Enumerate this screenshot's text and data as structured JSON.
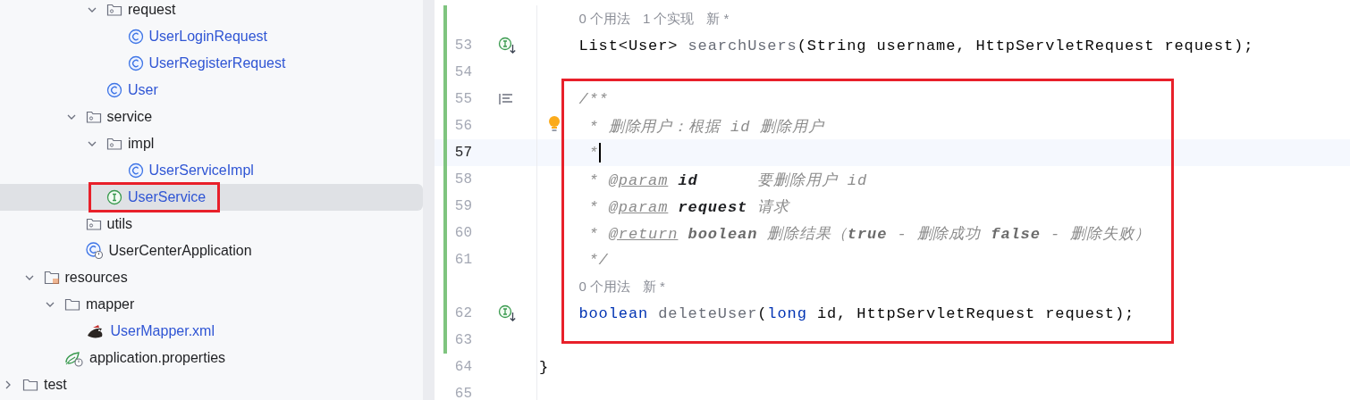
{
  "project_tree": [
    {
      "children": [
        {
          "children": [
            {
              "children": [
                {
                  "children": [
                    {
                      "name": "request",
                      "kind": "package",
                      "expanded": true,
                      "selected": false,
                      "added": false,
                      "children": [
                        {
                          "name": "UserLoginRequest",
                          "kind": "class",
                          "selected": false,
                          "added": true
                        },
                        {
                          "name": "UserRegisterRequest",
                          "kind": "class",
                          "selected": false,
                          "added": true
                        }
                      ]
                    },
                    {
                      "name": "User",
                      "kind": "class",
                      "selected": false,
                      "added": true
                    }
                  ]
                },
                {
                  "name": "service",
                  "kind": "package",
                  "expanded": true,
                  "selected": false,
                  "added": false,
                  "children": [
                    {
                      "name": "impl",
                      "kind": "package",
                      "expanded": true,
                      "selected": false,
                      "added": false,
                      "children": [
                        {
                          "name": "UserServiceImpl",
                          "kind": "class",
                          "selected": false,
                          "added": true
                        }
                      ]
                    },
                    {
                      "name": "UserService",
                      "kind": "interface",
                      "selected": true,
                      "added": true,
                      "boxed": true
                    }
                  ]
                },
                {
                  "name": "utils",
                  "kind": "package",
                  "selected": false,
                  "added": false
                },
                {
                  "name": "UserCenterApplication",
                  "kind": "app",
                  "selected": false,
                  "added": false
                }
              ]
            }
          ]
        },
        {
          "name": "resources",
          "kind": "resources",
          "expanded": true,
          "selected": false,
          "added": false,
          "children": [
            {
              "name": "mapper",
              "kind": "folder",
              "expanded": true,
              "selected": false,
              "added": false,
              "children": [
                {
                  "name": "UserMapper.xml",
                  "kind": "mybatis",
                  "selected": false,
                  "added": true
                }
              ]
            },
            {
              "name": "application.properties",
              "kind": "properties",
              "selected": false,
              "added": false
            }
          ]
        }
      ]
    },
    {
      "name": "test",
      "kind": "folder",
      "expanded": false,
      "selected": false,
      "added": false
    }
  ],
  "editor": {
    "blocks": [
      {
        "kind": "member",
        "boxed": false,
        "lines": [
          {
            "kind": "hint",
            "changed": true,
            "hints": [
              "0 个用法",
              "1 个实现",
              "新 *"
            ]
          },
          {
            "kind": "code",
            "number": "53",
            "changed": true,
            "current": false,
            "gutter": {
              "kind": "implemented"
            },
            "tokens": [
              {
                "text": "List<User> ",
                "kind": "plain"
              },
              {
                "text": "searchUsers",
                "kind": "method"
              },
              {
                "text": "(String username, HttpServletRequest request);",
                "kind": "plain"
              }
            ]
          },
          {
            "kind": "code",
            "number": "54",
            "changed": true,
            "current": false
          }
        ]
      },
      {
        "kind": "member",
        "boxed": true,
        "lines": [
          {
            "kind": "code",
            "number": "55",
            "changed": true,
            "current": false,
            "gutter": {
              "kind": "doc"
            },
            "tokens": [
              {
                "text": "/**",
                "kind": "comment"
              }
            ]
          },
          {
            "kind": "code",
            "number": "56",
            "changed": true,
            "current": false,
            "bulb": true,
            "tokens": [
              {
                "text": " * 删除用户：根据 id 删除用户",
                "kind": "comment"
              }
            ]
          },
          {
            "kind": "code",
            "number": "57",
            "changed": true,
            "current": true,
            "tokens": [
              {
                "text": " *",
                "kind": "comment"
              }
            ]
          },
          {
            "kind": "code",
            "number": "58",
            "changed": true,
            "current": false,
            "tokens": [
              {
                "text": " * ",
                "kind": "comment"
              },
              {
                "text": "@param",
                "kind": "doc-tag"
              },
              {
                "text": " id",
                "kind": "doc-param"
              },
              {
                "text": "      要删除用户 id",
                "kind": "comment"
              }
            ]
          },
          {
            "kind": "code",
            "number": "59",
            "changed": true,
            "current": false,
            "tokens": [
              {
                "text": " * ",
                "kind": "comment"
              },
              {
                "text": "@param",
                "kind": "doc-tag"
              },
              {
                "text": " request",
                "kind": "doc-param"
              },
              {
                "text": " 请求",
                "kind": "comment"
              }
            ]
          },
          {
            "kind": "code",
            "number": "60",
            "changed": true,
            "current": false,
            "tokens": [
              {
                "text": " * ",
                "kind": "comment"
              },
              {
                "text": "@return",
                "kind": "doc-tag"
              },
              {
                "text": " boolean",
                "kind": "doc-value"
              },
              {
                "text": " 删除结果（",
                "kind": "comment"
              },
              {
                "text": "true",
                "kind": "doc-value"
              },
              {
                "text": " - 删除成功 ",
                "kind": "comment"
              },
              {
                "text": "false",
                "kind": "doc-value"
              },
              {
                "text": " - 删除失败）",
                "kind": "comment"
              }
            ]
          },
          {
            "kind": "code",
            "number": "61",
            "changed": true,
            "current": false,
            "tokens": [
              {
                "text": " */",
                "kind": "comment"
              }
            ]
          },
          {
            "kind": "hint",
            "changed": true,
            "hints": [
              "0 个用法",
              "新 *"
            ]
          },
          {
            "kind": "code",
            "number": "62",
            "changed": true,
            "current": false,
            "gutter": {
              "kind": "implemented"
            },
            "tokens": [
              {
                "text": "boolean ",
                "kind": "keyword"
              },
              {
                "text": "deleteUser",
                "kind": "method"
              },
              {
                "text": "(",
                "kind": "plain"
              },
              {
                "text": "long",
                "kind": "keyword"
              },
              {
                "text": " id, HttpServletRequest request);",
                "kind": "plain"
              }
            ]
          },
          {
            "kind": "code",
            "number": "63",
            "changed": true,
            "current": false
          }
        ]
      },
      {
        "kind": "top",
        "boxed": false,
        "lines": [
          {
            "kind": "code",
            "number": "64",
            "changed": false,
            "current": false,
            "tokens": [
              {
                "text": "}",
                "kind": "plain"
              }
            ]
          },
          {
            "kind": "code",
            "number": "65",
            "changed": false,
            "current": false
          }
        ]
      }
    ]
  }
}
